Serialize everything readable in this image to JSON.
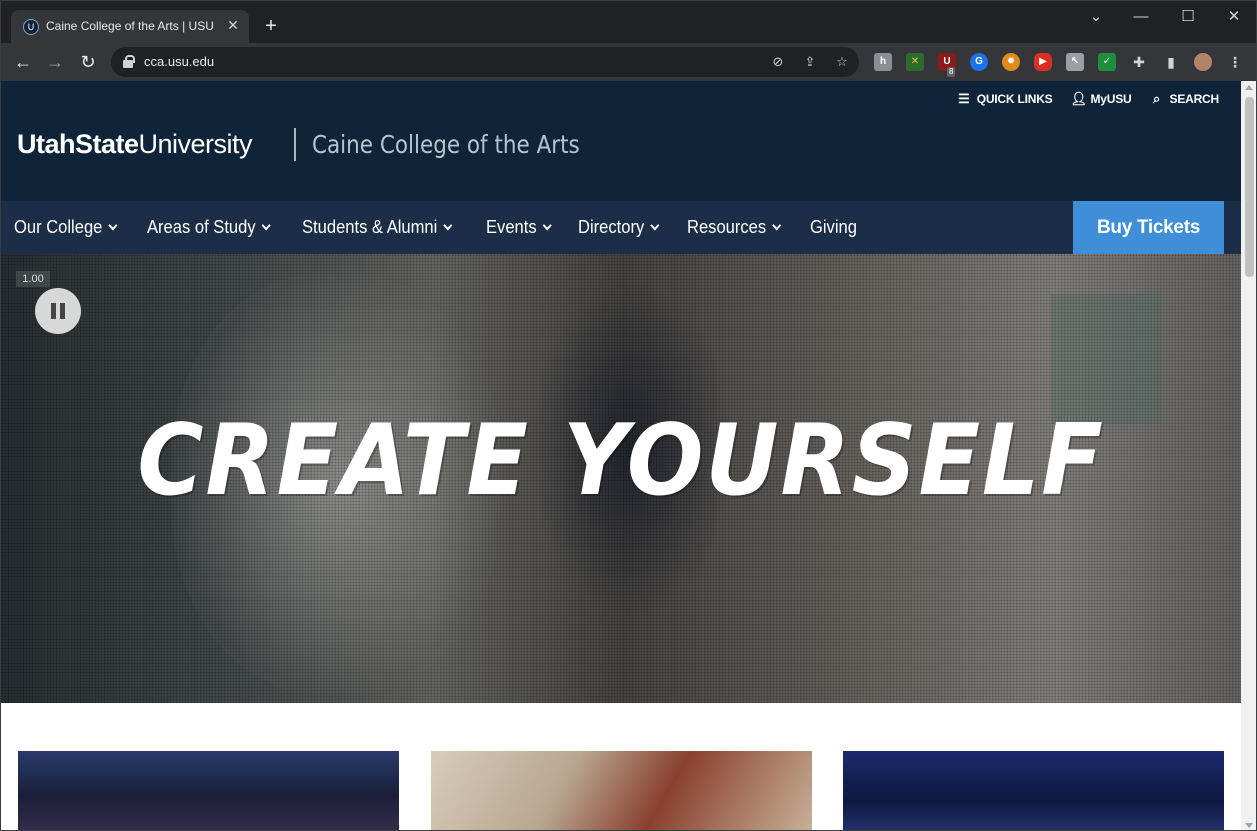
{
  "browser": {
    "tab_title": "Caine College of the Arts | USU",
    "tab_favicon_text": "U",
    "url": "cca.usu.edu",
    "extension_badge": "8"
  },
  "header": {
    "utility": {
      "quick_links": "QUICK LINKS",
      "myusu": "MyUSU",
      "search": "SEARCH"
    },
    "wordmark": {
      "bold": "UtahState",
      "regular": "University"
    },
    "college_name": "Caine College of the Arts"
  },
  "nav": {
    "items": [
      {
        "label": "Our College",
        "has_dropdown": true
      },
      {
        "label": "Areas of Study",
        "has_dropdown": true
      },
      {
        "label": "Students & Alumni",
        "has_dropdown": true
      },
      {
        "label": "Events",
        "has_dropdown": true
      },
      {
        "label": "Directory",
        "has_dropdown": true
      },
      {
        "label": "Resources",
        "has_dropdown": true
      },
      {
        "label": "Giving",
        "has_dropdown": false
      }
    ],
    "cta": "Buy Tickets"
  },
  "hero": {
    "counter": "1.00",
    "headline": "CREATE YOURSELF"
  },
  "colors": {
    "header_bg": "#0f2439",
    "nav_bg": "#1b2d47",
    "cta_bg": "#3f8ed8"
  }
}
